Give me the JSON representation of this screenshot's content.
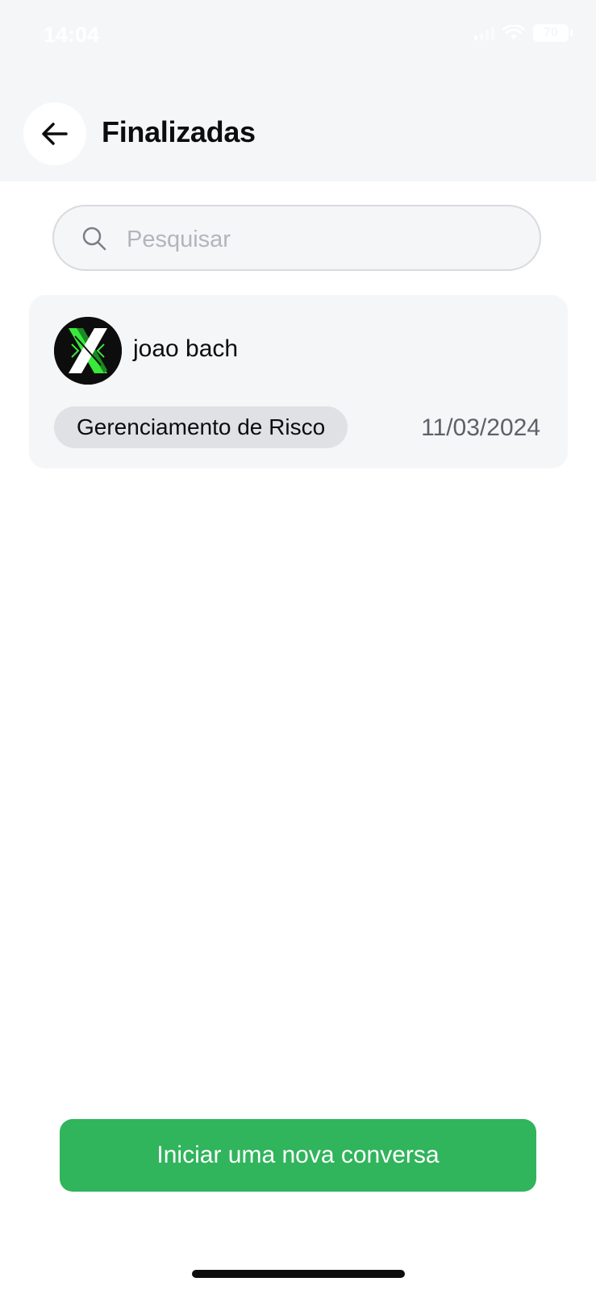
{
  "status_bar": {
    "time": "14:04",
    "battery": "70",
    "icons": [
      "signal-icon",
      "wifi-icon",
      "battery-icon"
    ]
  },
  "header": {
    "title": "Finalizadas",
    "back_icon": "arrow-left-icon"
  },
  "search": {
    "placeholder": "Pesquisar",
    "value": "",
    "icon": "search-icon"
  },
  "conversations": [
    {
      "name": "joao bach",
      "tag": "Gerenciamento de Risco",
      "date": "11/03/2024",
      "avatar": "x-logo-avatar"
    }
  ],
  "footer": {
    "new_conversation_label": "Iniciar uma nova conversa"
  },
  "colors": {
    "primary": "#30b45c",
    "header_bg": "#f5f6f8",
    "card_bg": "#f5f6f8",
    "tag_bg": "#dfe1e5",
    "logo_accent": "#39e83a"
  }
}
